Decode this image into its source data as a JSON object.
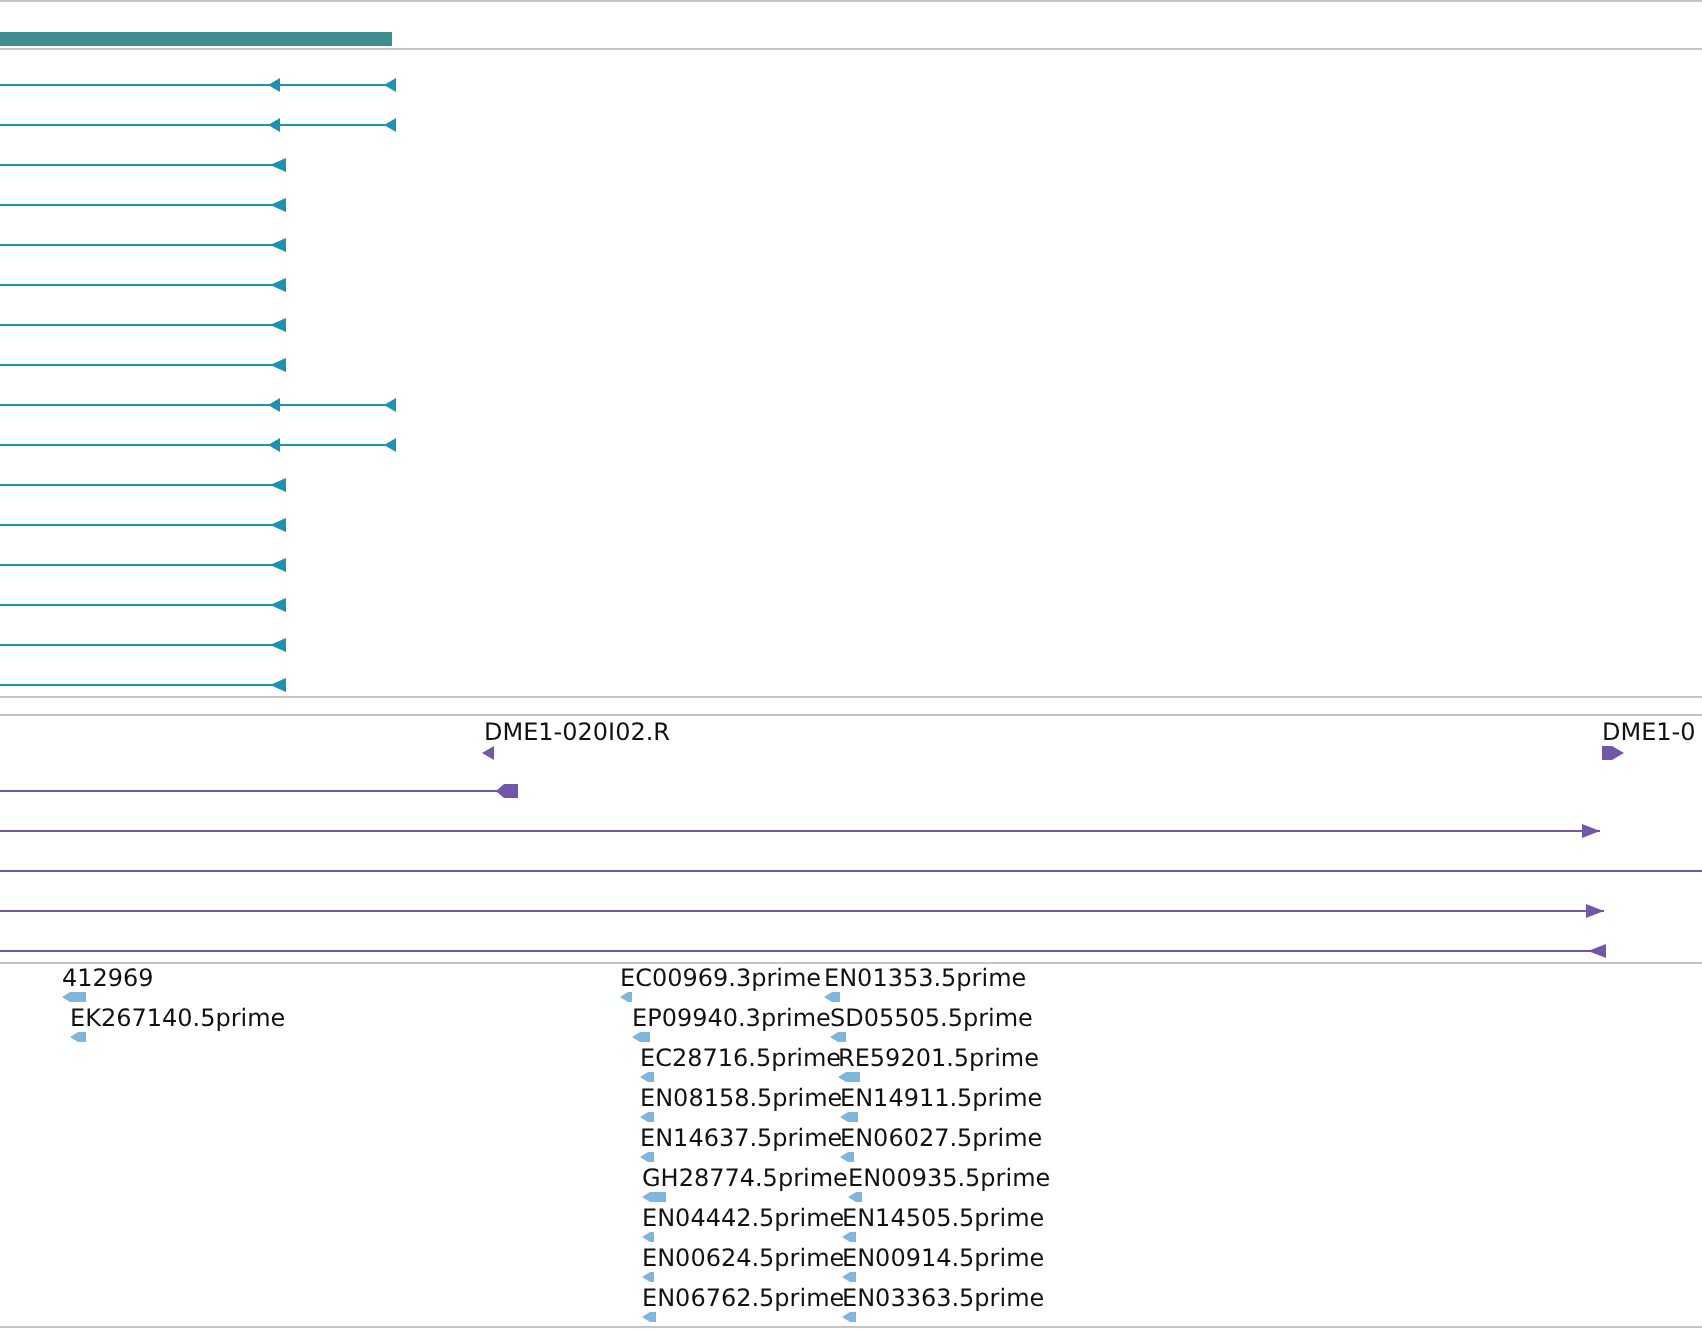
{
  "tracks": [
    {
      "kind": "coverage"
    },
    {
      "kind": "transcripts",
      "rows": [
        {
          "kind": "split"
        },
        {
          "kind": "split"
        },
        {
          "kind": "single"
        },
        {
          "kind": "single"
        },
        {
          "kind": "single"
        },
        {
          "kind": "single"
        },
        {
          "kind": "single"
        },
        {
          "kind": "single"
        },
        {
          "kind": "split"
        },
        {
          "kind": "split"
        },
        {
          "kind": "single"
        },
        {
          "kind": "single"
        },
        {
          "kind": "single"
        },
        {
          "kind": "single"
        },
        {
          "kind": "single"
        },
        {
          "kind": "single"
        }
      ]
    },
    {
      "kind": "spacer"
    },
    {
      "kind": "alignments",
      "labels": [
        {
          "label": "DME1-020I02.R",
          "kind": "reverse"
        },
        {
          "label": "DME1-0",
          "kind": "forward"
        }
      ],
      "rows": [
        {
          "kind": "short"
        },
        {
          "kind": "forward"
        },
        {
          "kind": "full"
        },
        {
          "kind": "forward"
        },
        {
          "kind": "reverse"
        }
      ]
    },
    {
      "kind": "ests",
      "features": [
        {
          "label": "412969"
        },
        {
          "label": "EK267140.5prime"
        },
        {
          "label": "EC00969.3prime"
        },
        {
          "label": "EP09940.3prime"
        },
        {
          "label": "EC28716.5prime"
        },
        {
          "label": "EN08158.5prime"
        },
        {
          "label": "EN14637.5prime"
        },
        {
          "label": "GH28774.5prime"
        },
        {
          "label": "EN04442.5prime"
        },
        {
          "label": "EN00624.5prime"
        },
        {
          "label": "EN06762.5prime"
        },
        {
          "label": "EN01353.5prime"
        },
        {
          "label": "SD05505.5prime"
        },
        {
          "label": "RE59201.5prime"
        },
        {
          "label": "EN14911.5prime"
        },
        {
          "label": "EN06027.5prime"
        },
        {
          "label": "EN00935.5prime"
        },
        {
          "label": "EN14505.5prime"
        },
        {
          "label": "EN00914.5prime"
        },
        {
          "label": "EN03363.5prime"
        }
      ]
    }
  ]
}
